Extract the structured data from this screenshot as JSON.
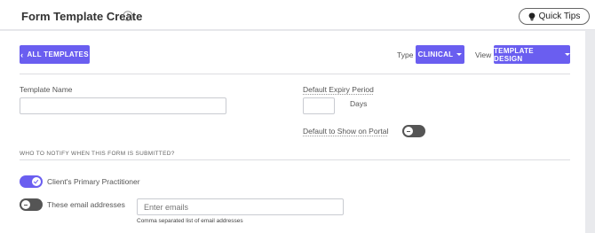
{
  "header": {
    "title": "Form Template Create",
    "quick_tips_label": "Quick Tips"
  },
  "toolbar": {
    "all_templates_label": "ALL TEMPLATES",
    "type_label": "Type",
    "type_value": "CLINICAL",
    "view_label": "View",
    "view_value": "TEMPLATE DESIGN"
  },
  "form": {
    "template_name_label": "Template Name",
    "template_name_value": "",
    "default_expiry_label": "Default Expiry Period",
    "default_expiry_value": "",
    "expiry_unit": "Days",
    "show_on_portal_label": "Default to Show on Portal",
    "show_on_portal_on": false
  },
  "notify": {
    "heading": "WHO TO NOTIFY WHEN THIS FORM IS SUBMITTED?",
    "primary_practitioner_label": "Client's Primary Practitioner",
    "primary_practitioner_on": true,
    "email_addresses_label": "These email addresses",
    "email_addresses_on": false,
    "emails_placeholder": "Enter emails",
    "emails_hint": "Comma separated list of email addresses"
  },
  "colors": {
    "accent": "#6a5ef0",
    "toggle_off": "#555555"
  }
}
